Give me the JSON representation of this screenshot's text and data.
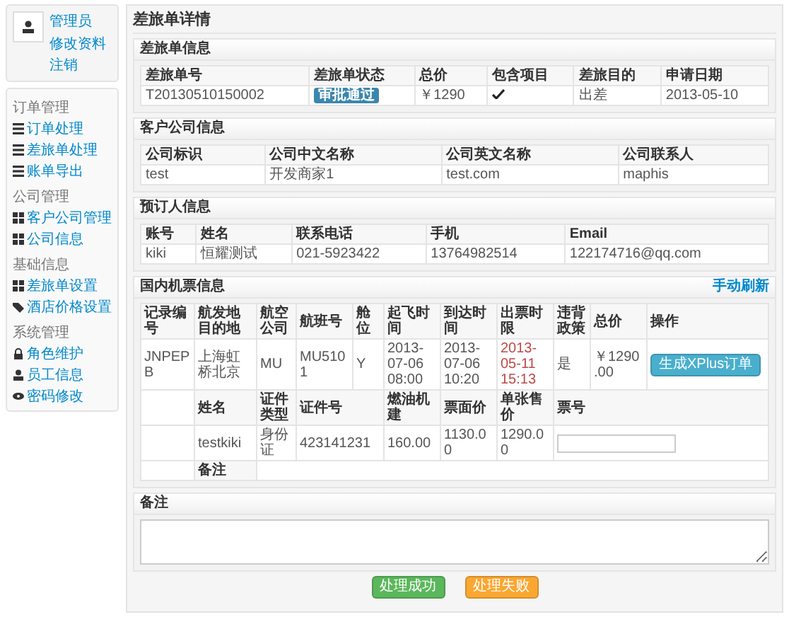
{
  "sidebar": {
    "user": {
      "name": "管理员",
      "links": [
        "修改资料",
        "注销"
      ]
    },
    "groups": [
      {
        "title": "订单管理",
        "items": [
          "订单处理",
          "差旅单处理",
          "账单导出"
        ]
      },
      {
        "title": "公司管理",
        "items": [
          "客户公司管理",
          "公司信息"
        ]
      },
      {
        "title": "基础信息",
        "items": [
          "差旅单设置",
          "酒店价格设置"
        ]
      },
      {
        "title": "系统管理",
        "items": [
          "角色维护",
          "员工信息",
          "密码修改"
        ]
      }
    ]
  },
  "page_title": "差旅单详情",
  "sections": [
    {
      "title": "差旅单信息",
      "columns": [
        "差旅单号",
        "差旅单状态",
        "总价",
        "包含项目",
        "差旅目的",
        "申请日期"
      ],
      "rows": [
        [
          {
            "kind": "text",
            "text": "T20130510150002"
          },
          {
            "kind": "badge",
            "text": "审批通过"
          },
          {
            "kind": "text",
            "text": "￥1290"
          },
          {
            "kind": "check",
            "checked": true
          },
          {
            "kind": "text",
            "text": "出差"
          },
          {
            "kind": "text",
            "text": "2013-05-10"
          }
        ]
      ]
    },
    {
      "title": "客户公司信息",
      "columns": [
        "公司标识",
        "公司中文名称",
        "公司英文名称",
        "公司联系人"
      ],
      "rows": [
        [
          {
            "kind": "text",
            "text": "test"
          },
          {
            "kind": "text",
            "text": "开发商家1"
          },
          {
            "kind": "text",
            "text": "test.com"
          },
          {
            "kind": "text",
            "text": "maphis"
          }
        ]
      ]
    },
    {
      "title": "预订人信息",
      "columns": [
        "账号",
        "姓名",
        "联系电话",
        "手机",
        "Email"
      ],
      "rows": [
        [
          {
            "kind": "text",
            "text": "kiki"
          },
          {
            "kind": "text",
            "text": "恒耀测试"
          },
          {
            "kind": "text",
            "text": "021-5923422"
          },
          {
            "kind": "text",
            "text": "13764982514"
          },
          {
            "kind": "text",
            "text": "122174716@qq.com"
          }
        ]
      ]
    }
  ],
  "flight": {
    "title": "国内机票信息",
    "refresh_link": "手动刷新",
    "columns": [
      "记录编号",
      "航发地目的地",
      "航空公司",
      "航班号",
      "舱位",
      "起飞时间",
      "到达时间",
      "出票时限",
      "违背政策",
      "总价",
      "操作"
    ],
    "row": [
      {
        "kind": "text",
        "text": "JNPEPB"
      },
      {
        "kind": "text",
        "text": "上海虹桥北京"
      },
      {
        "kind": "text",
        "text": "MU"
      },
      {
        "kind": "text",
        "text": "MU5101"
      },
      {
        "kind": "text",
        "text": "Y"
      },
      {
        "kind": "text",
        "text": "2013-07-06 08:00"
      },
      {
        "kind": "text",
        "text": "2013-07-06 10:20"
      },
      {
        "kind": "alert",
        "text": "2013-05-11 15:13"
      },
      {
        "kind": "text",
        "text": "是"
      },
      {
        "kind": "text",
        "text": "￥1290.00"
      },
      {
        "kind": "button",
        "text": "生成XPlus订单"
      }
    ],
    "passenger_columns": [
      "姓名",
      "证件类型",
      "证件号",
      "燃油机建",
      "票面价",
      "单张售价",
      "票号"
    ],
    "passenger_row": [
      {
        "kind": "text",
        "text": "testkiki"
      },
      {
        "kind": "text",
        "text": "身份证"
      },
      {
        "kind": "text",
        "text": "423141231"
      },
      {
        "kind": "text",
        "text": "160.00"
      },
      {
        "kind": "text",
        "text": "1130.00"
      },
      {
        "kind": "text",
        "text": "1290.00"
      },
      {
        "kind": "input"
      }
    ],
    "remark_label": "备注"
  },
  "remarks": {
    "title": "备注"
  },
  "buttons": [
    {
      "label": "处理成功",
      "kind": "success"
    },
    {
      "label": "处理失败",
      "kind": "warning"
    }
  ]
}
